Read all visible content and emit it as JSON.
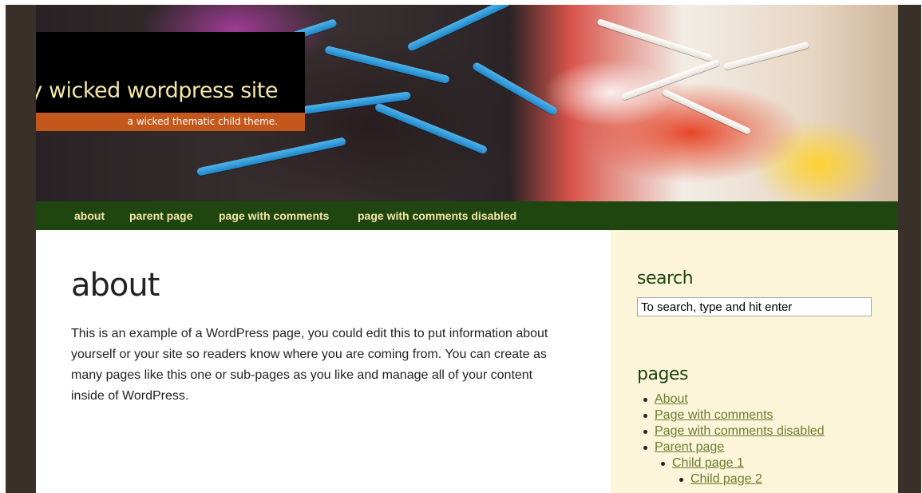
{
  "header": {
    "site_title": "my wicked wordpress site",
    "tagline": "a wicked thematic child theme."
  },
  "nav": {
    "items": [
      {
        "label": "about"
      },
      {
        "label": "parent page"
      },
      {
        "label": "page with comments"
      },
      {
        "label": "page with comments disabled"
      }
    ]
  },
  "main": {
    "title": "about",
    "body": "This is an example of a WordPress page, you could edit this to put information about yourself or your site so readers know where you are coming from. You can create as many pages like this one or sub-pages as you like and manage all of your content inside of WordPress."
  },
  "sidebar": {
    "search": {
      "title": "search",
      "input_value": "To search, type and hit enter"
    },
    "pages": {
      "title": "pages",
      "items": [
        {
          "label": "About"
        },
        {
          "label": "Page with comments"
        },
        {
          "label": "Page with comments disabled"
        },
        {
          "label": "Parent page"
        },
        {
          "label": "Child page 1"
        },
        {
          "label": "Child page 2"
        }
      ]
    }
  },
  "colors": {
    "frame": "#3a302a",
    "nav_bg": "#1f4510",
    "nav_text": "#f3e6a8",
    "tagline_bg": "#c4571b",
    "sidebar_bg": "#fdf5da",
    "link": "#6b7c2e"
  }
}
